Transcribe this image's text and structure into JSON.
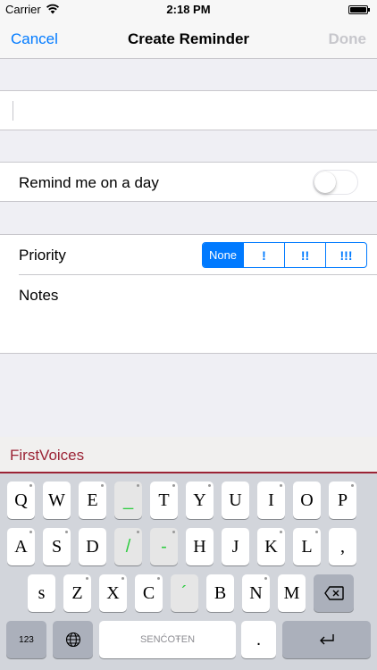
{
  "status": {
    "carrier": "Carrier",
    "time": "2:18 PM"
  },
  "nav": {
    "cancel": "Cancel",
    "title": "Create Reminder",
    "done": "Done"
  },
  "form": {
    "title_value": "",
    "remind_label": "Remind me on a day",
    "remind_on": false,
    "priority_label": "Priority",
    "priority_options": [
      "None",
      "!",
      "!!",
      "!!!"
    ],
    "priority_selected": "None",
    "notes_label": "Notes"
  },
  "keyboard": {
    "brand": "FirstVoices",
    "row1": [
      "Q",
      "W",
      "E",
      "_",
      "T",
      "Y",
      "U",
      "I",
      "O",
      "P"
    ],
    "row2": [
      "A",
      "S",
      "D",
      "/",
      "-",
      "H",
      "J",
      "K",
      "L",
      ","
    ],
    "row3": [
      "s",
      "Z",
      "X",
      "C",
      "´",
      "B",
      "N",
      "M"
    ],
    "numbers_label": "123",
    "space_label": "SENĆOŦEN",
    "period_label": ".",
    "accent_color": "#9b2335",
    "special_key_color": "#2ecc40"
  }
}
